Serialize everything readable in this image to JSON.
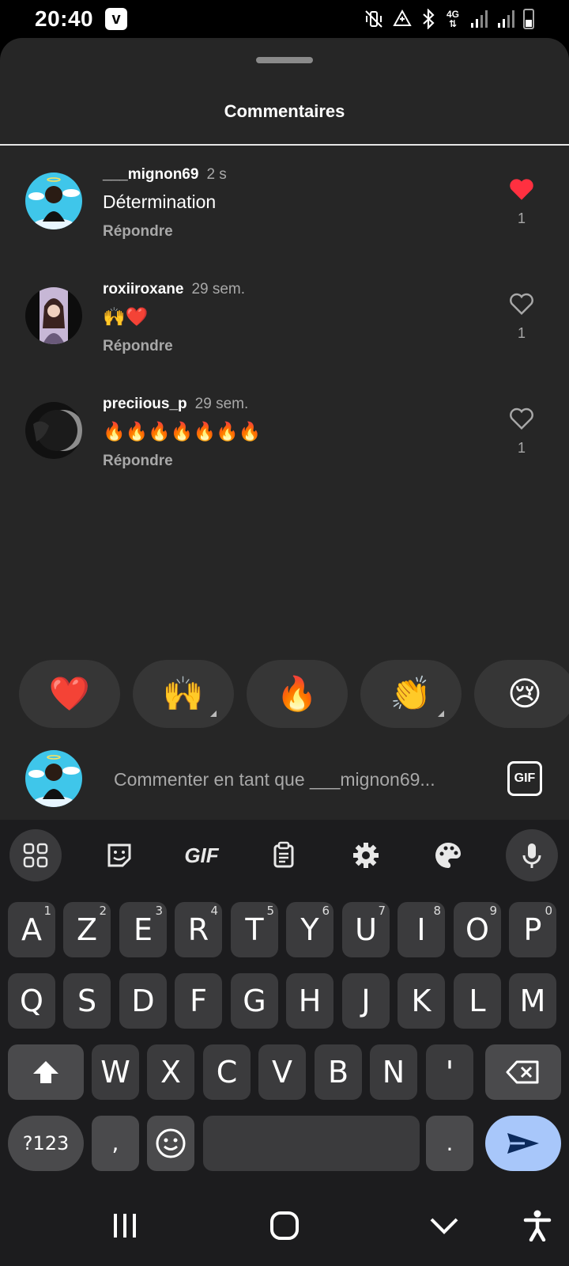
{
  "status_bar": {
    "time": "20:40",
    "app_badge": "v",
    "network": "4G",
    "icons": [
      "mute-vibrate-icon",
      "data-saver-icon",
      "bluetooth-icon",
      "network-4g-icon",
      "signal-icon",
      "signal-icon",
      "battery-icon"
    ]
  },
  "sheet": {
    "title": "Commentaires"
  },
  "comments": [
    {
      "username": "___mignon69",
      "time": "2 s",
      "text": "Détermination",
      "reply_label": "Répondre",
      "likes": "1",
      "liked": true
    },
    {
      "username": "roxiiroxane",
      "time": "29 sem.",
      "text": "🙌❤️",
      "reply_label": "Répondre",
      "likes": "1",
      "liked": false
    },
    {
      "username": "preciious_p",
      "time": "29 sem.",
      "text": "🔥🔥🔥🔥🔥🔥🔥",
      "reply_label": "Répondre",
      "likes": "1",
      "liked": false
    }
  ],
  "reactions": [
    "❤️",
    "🙌",
    "🔥",
    "👏",
    "😢"
  ],
  "comment_input": {
    "placeholder": "Commenter en tant que ___mignon69...",
    "gif_label": "GIF"
  },
  "keyboard": {
    "toolbar": [
      "apps-grid-icon",
      "sticker-icon",
      "GIF",
      "clipboard-icon",
      "settings-icon",
      "palette-icon",
      "microphone-icon"
    ],
    "toolbar_gif": "GIF",
    "row1": [
      {
        "k": "A",
        "h": "1"
      },
      {
        "k": "Z",
        "h": "2"
      },
      {
        "k": "E",
        "h": "3"
      },
      {
        "k": "R",
        "h": "4"
      },
      {
        "k": "T",
        "h": "5"
      },
      {
        "k": "Y",
        "h": "6"
      },
      {
        "k": "U",
        "h": "7"
      },
      {
        "k": "I",
        "h": "8"
      },
      {
        "k": "O",
        "h": "9"
      },
      {
        "k": "P",
        "h": "0"
      }
    ],
    "row2": [
      "Q",
      "S",
      "D",
      "F",
      "G",
      "H",
      "J",
      "K",
      "L",
      "M"
    ],
    "row3": [
      "W",
      "X",
      "C",
      "V",
      "B",
      "N",
      "'"
    ],
    "symbols_label": "?123",
    "comma": ",",
    "period": "."
  },
  "colors": {
    "sheet_bg": "#262626",
    "like_red": "#ff3040",
    "send_key": "#a8c7fa",
    "muted_text": "#a8a8a8"
  }
}
